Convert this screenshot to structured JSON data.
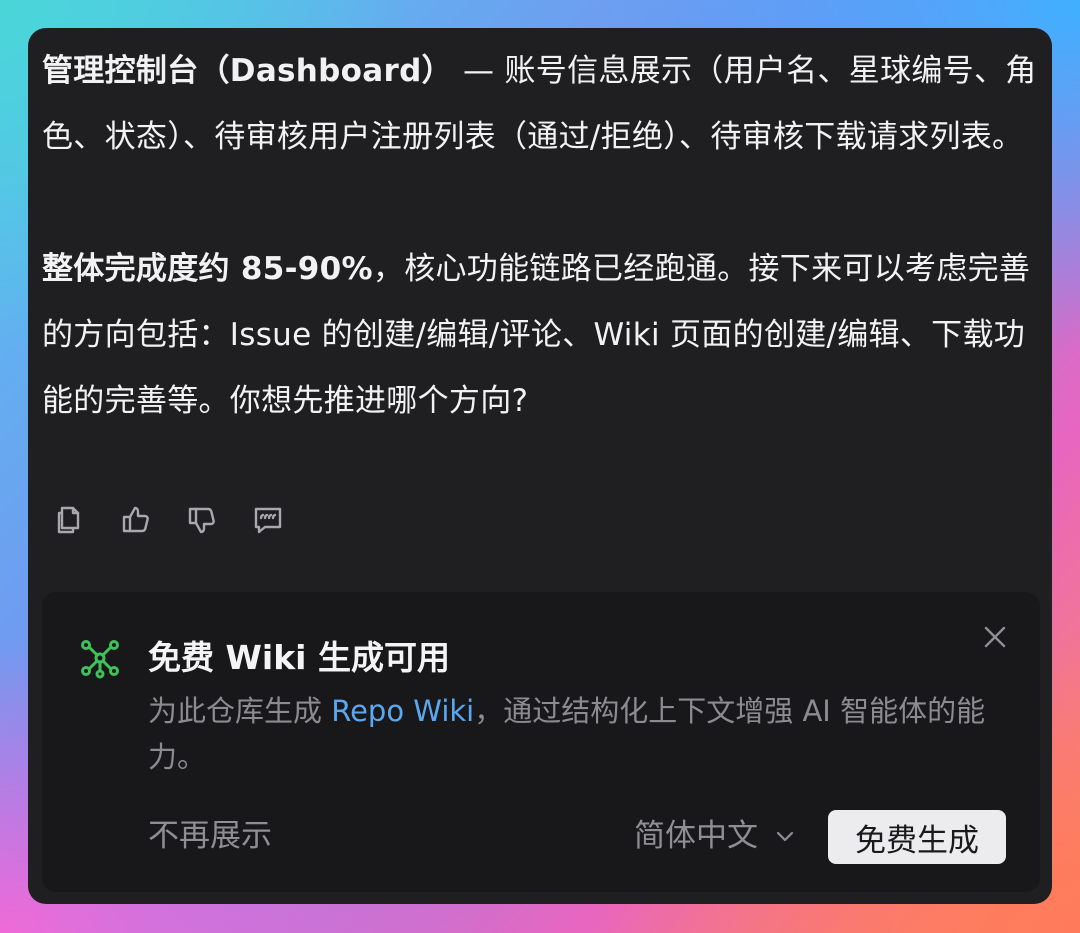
{
  "message": {
    "para1_bold": "管理控制台（Dashboard）",
    "para1_rest": " — 账号信息展示（用户名、星球编号、角色、状态）、待审核用户注册列表（通过/拒绝）、待审核下载请求列表。",
    "para2_bold": "整体完成度约 85-90%",
    "para2_rest": "，核心功能链路已经跑通。接下来可以考虑完善的方向包括：Issue 的创建/编辑/评论、Wiki 页面的创建/编辑、下载功能的完善等。你想先推进哪个方向?"
  },
  "actions": {
    "icons": [
      "copy-icon",
      "thumbs-up-icon",
      "thumbs-down-icon",
      "quote-icon"
    ]
  },
  "banner": {
    "title": "免费 Wiki 生成可用",
    "desc_before": "为此仓库生成 ",
    "desc_link": "Repo Wiki",
    "desc_after": "，通过结构化上下文增强 AI 智能体的能力。",
    "dismiss_label": "不再展示",
    "language_value": "简体中文",
    "generate_label": "免费生成",
    "icon_color": "#3fc25a",
    "link_color": "#5aa8f0"
  }
}
